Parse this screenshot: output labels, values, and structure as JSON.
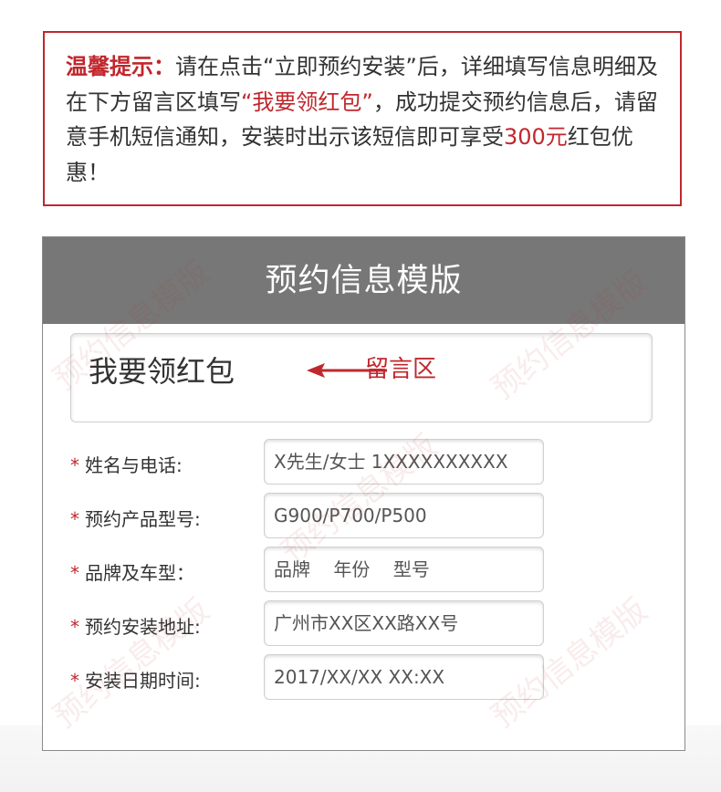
{
  "notice": {
    "title": "温馨提示：",
    "text1": "请在点击“立即预约安装”后，详细填写信息明细及在下方留言区填写",
    "highlight1": "“我要领红包”",
    "text2": "，成功提交预约信息后，请留意手机短信通知，安装时出示该短信即可享受",
    "highlight2": "300元",
    "text3": "红包优惠！"
  },
  "card": {
    "header": "预约信息模版",
    "message": "我要领红包",
    "arrow_label": "留言区",
    "rows": [
      {
        "label": "姓名与电话:",
        "value": "X先生/女士 1XXXXXXXXXX"
      },
      {
        "label": "预约产品型号:",
        "value": "G900/P700/P500"
      },
      {
        "label": "品牌及车型：",
        "value": "品牌    年份    型号"
      },
      {
        "label": "预约安装地址:",
        "value": "广州市XX区XX路XX号"
      },
      {
        "label": "安装日期时间:",
        "value": "2017/XX/XX XX:XX"
      }
    ],
    "required_mark": "*"
  },
  "watermark": "预约信息模版",
  "colors": {
    "accent": "#c1272d",
    "header_bg": "#777777",
    "border": "#8a8a8a"
  }
}
